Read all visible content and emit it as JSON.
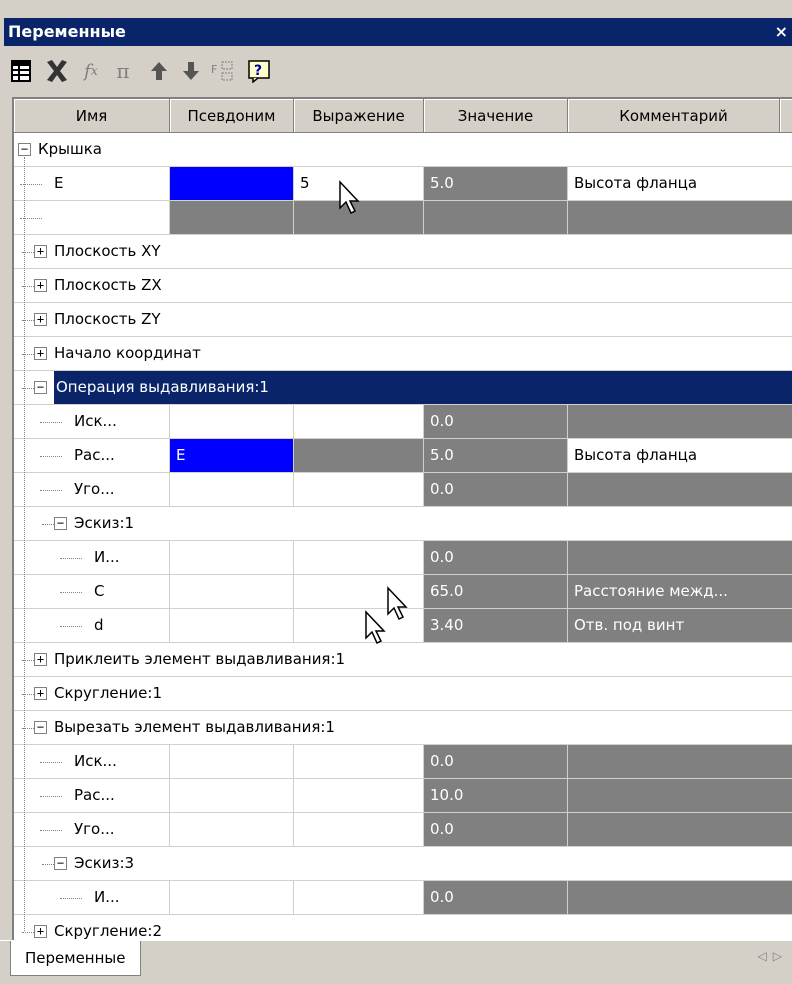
{
  "window": {
    "title": "Переменные",
    "close_glyph": "×"
  },
  "toolbar": {
    "icons": [
      "table-settings-icon",
      "delete-icon",
      "function-icon",
      "pi-icon",
      "move-up-icon",
      "move-down-icon",
      "formula-icon",
      "help-icon"
    ]
  },
  "columns": [
    "Имя",
    "Псевдоним",
    "Выражение",
    "Значение",
    "Комментарий"
  ],
  "rows": [
    {
      "type": "group",
      "label": "Крышка",
      "expanded": true
    },
    {
      "type": "var",
      "name": "E",
      "alias": "",
      "expr": "5",
      "value": "5.0",
      "comment": "Высота фланца"
    },
    {
      "type": "var",
      "name": "",
      "alias": "",
      "expr": "",
      "value": "",
      "comment": ""
    },
    {
      "type": "group",
      "label": "Плоскость XY",
      "expanded": false
    },
    {
      "type": "group",
      "label": "Плоскость ZX",
      "expanded": false
    },
    {
      "type": "group",
      "label": "Плоскость ZY",
      "expanded": false
    },
    {
      "type": "group",
      "label": "Начало координат",
      "expanded": false
    },
    {
      "type": "group",
      "label": "Операция выдавливания:1",
      "expanded": true,
      "selected": true
    },
    {
      "type": "var",
      "name": "Иск...",
      "alias": "",
      "expr": "",
      "value": "0.0",
      "comment": ""
    },
    {
      "type": "var",
      "name": "Рас...",
      "alias": "E",
      "expr": "",
      "value": "5.0",
      "comment": "Высота фланца"
    },
    {
      "type": "var",
      "name": "Уго...",
      "alias": "",
      "expr": "",
      "value": "0.0",
      "comment": ""
    },
    {
      "type": "group",
      "label": "Эскиз:1",
      "expanded": true
    },
    {
      "type": "var",
      "name": "И...",
      "alias": "",
      "expr": "",
      "value": "0.0",
      "comment": ""
    },
    {
      "type": "var",
      "name": "C",
      "alias": "",
      "expr": "",
      "value": "65.0",
      "comment": "Расстояние межд..."
    },
    {
      "type": "var",
      "name": "d",
      "alias": "",
      "expr": "",
      "value": "3.40",
      "comment": "Отв. под винт"
    },
    {
      "type": "group",
      "label": "Приклеить элемент выдавливания:1",
      "expanded": false
    },
    {
      "type": "group",
      "label": "Скругление:1",
      "expanded": false
    },
    {
      "type": "group",
      "label": "Вырезать элемент выдавливания:1",
      "expanded": true
    },
    {
      "type": "var",
      "name": "Иск...",
      "alias": "",
      "expr": "",
      "value": "0.0",
      "comment": ""
    },
    {
      "type": "var",
      "name": "Рас...",
      "alias": "",
      "expr": "",
      "value": "10.0",
      "comment": ""
    },
    {
      "type": "var",
      "name": "Уго...",
      "alias": "",
      "expr": "",
      "value": "0.0",
      "comment": ""
    },
    {
      "type": "group",
      "label": "Эскиз:3",
      "expanded": true
    },
    {
      "type": "var",
      "name": "И...",
      "alias": "",
      "expr": "",
      "value": "0.0",
      "comment": ""
    },
    {
      "type": "group",
      "label": "Скругление:2",
      "expanded": false
    }
  ],
  "bottom_tab": "Переменные",
  "colors": {
    "title_bg": "#0a246a",
    "alias_blue": "#0000ff",
    "readonly_gray": "#808080"
  }
}
